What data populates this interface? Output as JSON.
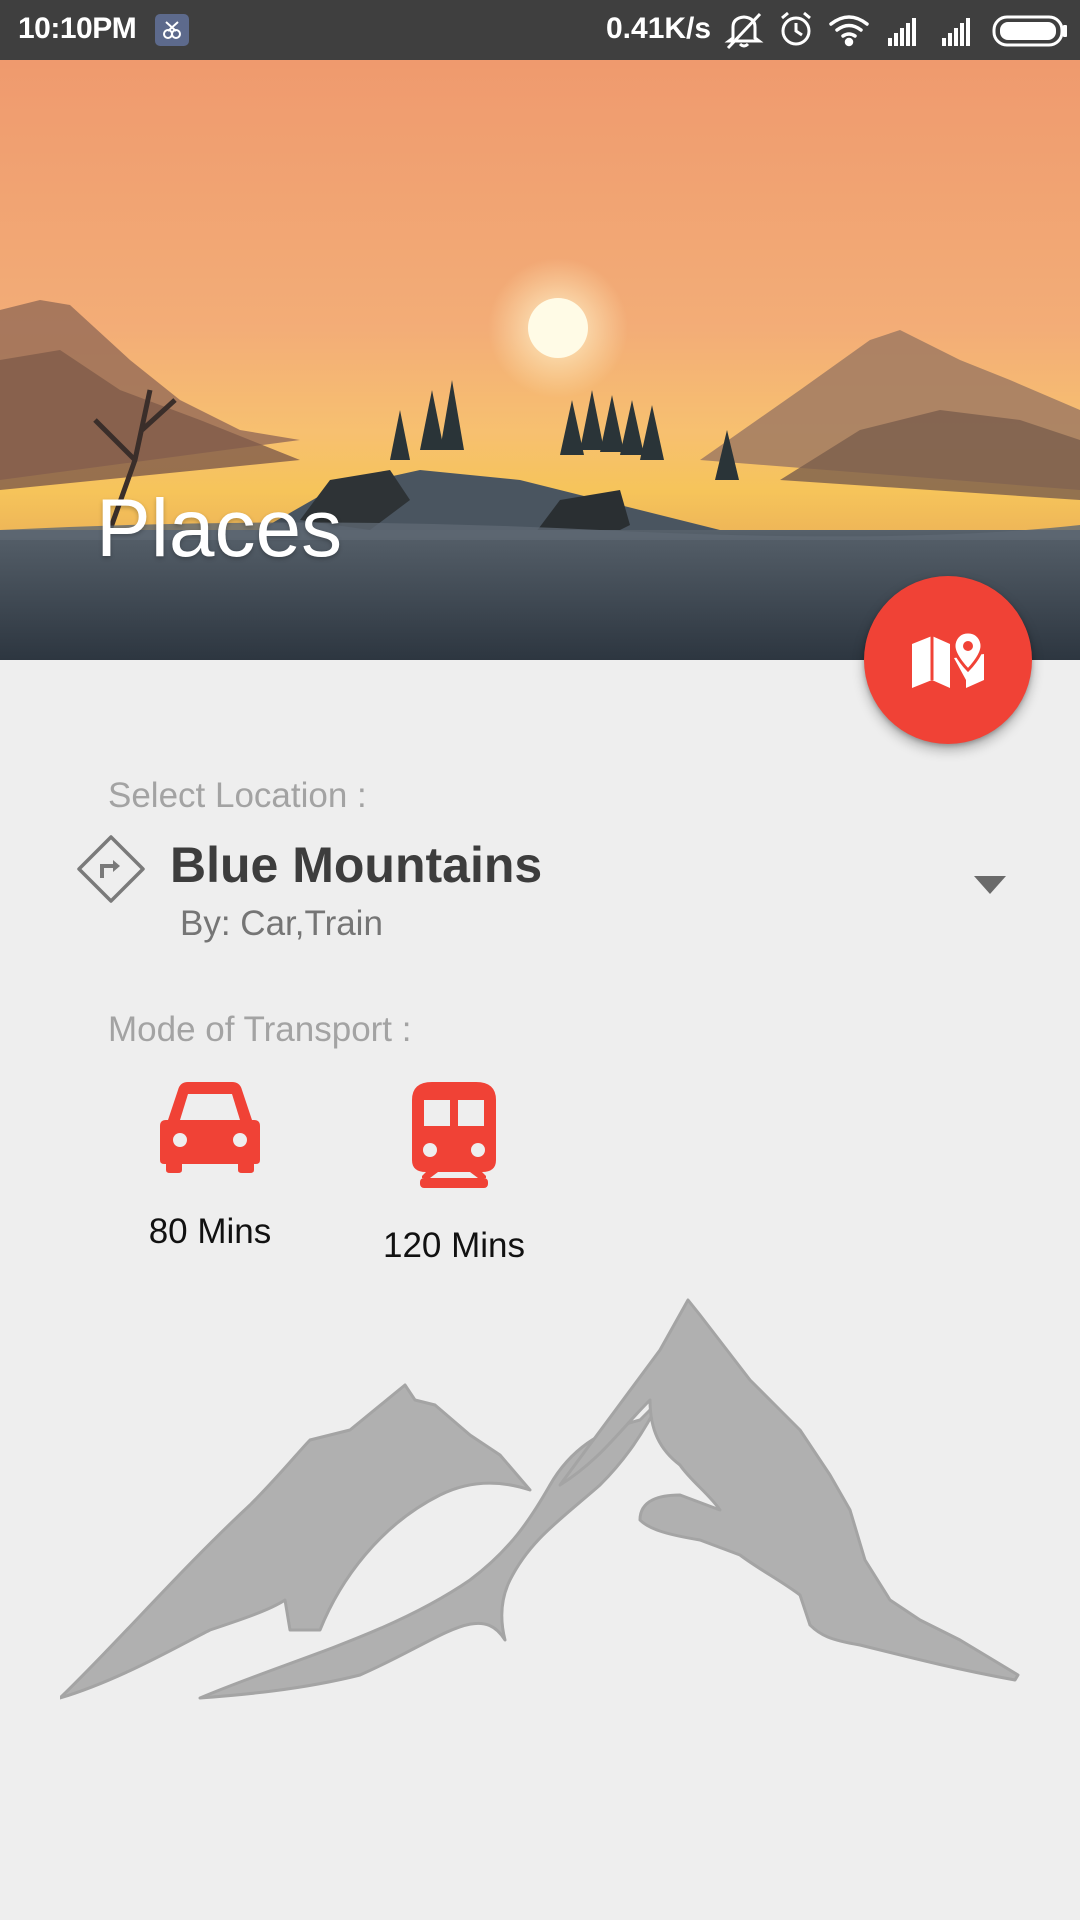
{
  "status_bar": {
    "time": "10:10PM",
    "network_speed": "0.41K/s",
    "icons": [
      "app-notification-icon",
      "mute-vibrate-icon",
      "alarm-icon",
      "wifi-icon",
      "signal-icon",
      "signal-icon",
      "battery-icon"
    ]
  },
  "header": {
    "title": "Places",
    "fab_icon": "map-pin-icon"
  },
  "location": {
    "label": "Select Location :",
    "icon": "directions-icon",
    "selected": "Blue Mountains",
    "by": "By: Car,Train"
  },
  "transport": {
    "label": "Mode of Transport :",
    "modes": [
      {
        "icon": "car-icon",
        "time": "80 Mins"
      },
      {
        "icon": "train-icon",
        "time": "120 Mins"
      }
    ]
  },
  "colors": {
    "accent": "#f04236",
    "status_bar": "#3f3f3f",
    "background": "#eeeeee",
    "mountain_graphic": "#b0b0b0"
  }
}
